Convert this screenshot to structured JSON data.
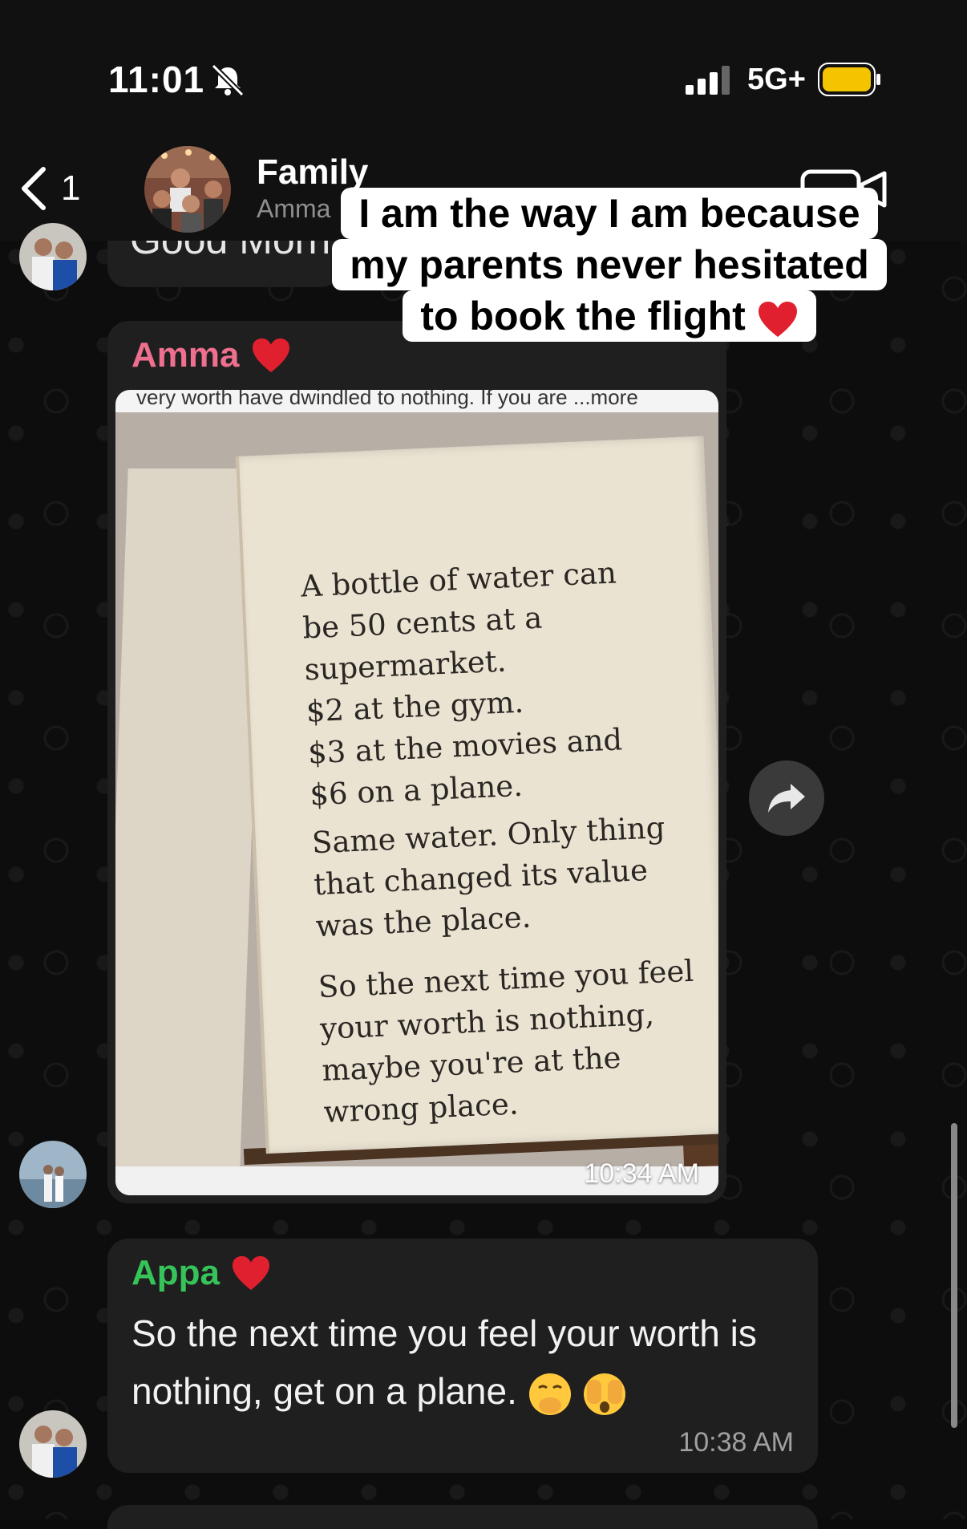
{
  "status_bar": {
    "time": "11:01",
    "network": "5G+",
    "icons": [
      "bell-off-icon",
      "signal-icon",
      "battery-icon"
    ],
    "battery_color": "#f5c400"
  },
  "header": {
    "back_count": "1",
    "group_name": "Family",
    "subtitle": "Amma",
    "icons": [
      "chevron-left-icon",
      "video-call-icon"
    ]
  },
  "caption": {
    "lines": [
      "I am the way I am because",
      "my parents never hesitated",
      "to book the flight"
    ],
    "emoji": "❤️"
  },
  "previous_message": {
    "text": "Good Morn"
  },
  "image_message": {
    "sender": "Amma",
    "sender_color": "#ef6f8f",
    "sender_emoji": "❤️",
    "preview_text": "very worth have dwindled to nothing. If you are   ...more",
    "page_text_1": "A bottle of water can\nbe  50 cents at a\nsupermarket.\n$2 at the gym.\n$3 at the movies and\n$6 on a plane.",
    "page_text_2": "Same water. Only thing\nthat changed its value\nwas the place.",
    "page_text_3": "So the next time you feel\nyour worth is nothing,\nmaybe you're at the\nwrong place.",
    "time": "10:34 AM"
  },
  "text_message": {
    "sender": "Appa",
    "sender_color": "#35c35a",
    "sender_emoji": "❤️",
    "text": "So the next time you feel your worth is nothing, get on a plane.",
    "emojis": [
      "hand-over-mouth-emoji",
      "face-with-open-eyes-and-hand-emoji"
    ],
    "time": "10:38 AM"
  }
}
